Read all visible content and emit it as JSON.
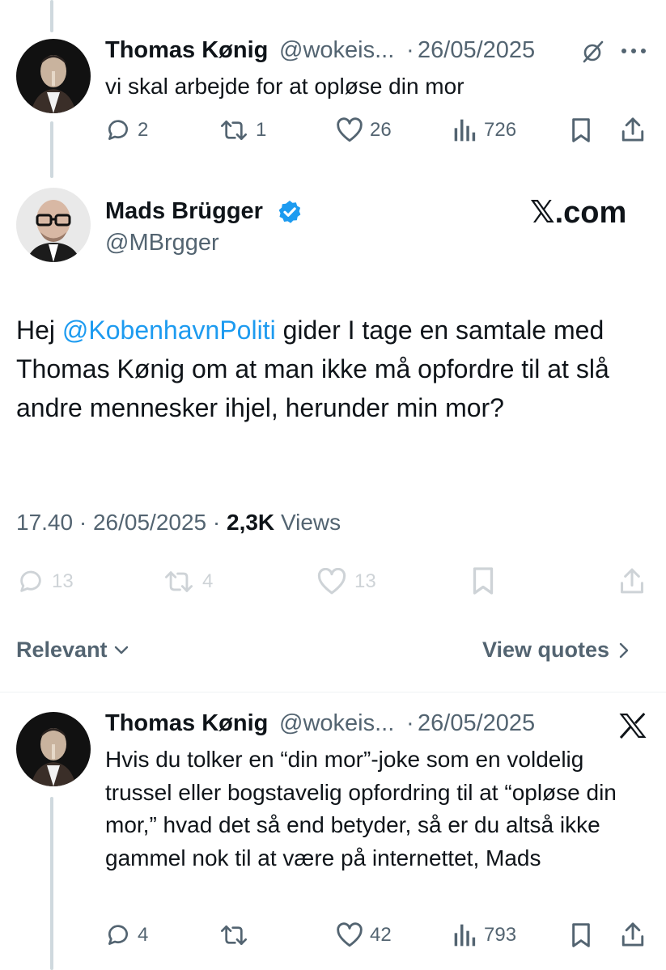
{
  "tweet1": {
    "author_name": "Thomas Kønig",
    "handle": "@wokeis...",
    "separator": "·",
    "date": "26/05/2025",
    "text": "vi skal arbejde for at opløse din mor",
    "replies": "2",
    "reposts": "1",
    "likes": "26",
    "views": "726"
  },
  "main_tweet": {
    "author_name": "Mads Brügger",
    "handle": "@MBrgger",
    "watermark": "𝕏.com",
    "text_before": "Hej ",
    "mention": "@KobenhavnPoliti",
    "text_after": " gider I tage en samtale med Thomas Kønig om at man ikke må opfordre til at slå andre mennesker ihjel, herunder min mor?",
    "time": "17.40",
    "separator": "·",
    "date": "26/05/2025",
    "separator2": "·",
    "views_count": "2,3K",
    "views_label": "Views",
    "replies": "13",
    "reposts": "4",
    "likes": "13"
  },
  "replies_header": {
    "sort_label": "Relevant",
    "quotes_label": "View quotes"
  },
  "tweet2": {
    "author_name": "Thomas Kønig",
    "handle": "@wokeis...",
    "separator": "·",
    "date": "26/05/2025",
    "text": "Hvis du tolker en “din mor”-joke som en voldelig trussel eller bogstavelig opfordring til at “opløse din mor,” hvad det så end betyder, så er du altså ikke gammel nok til at være på internettet, Mads",
    "replies": "4",
    "likes": "42",
    "views": "793"
  },
  "icons": {
    "verified": "verified-badge-icon",
    "grok": "grok-icon",
    "more": "more-icon",
    "reply": "reply-icon",
    "repost": "repost-icon",
    "like": "like-icon",
    "views": "views-icon",
    "bookmark": "bookmark-icon",
    "share": "share-icon",
    "x_logo": "x-logo-icon"
  },
  "colors": {
    "text": "#0f1419",
    "muted": "#536471",
    "link": "#1d9bf0",
    "verified": "#1d9bf0",
    "thread_line": "#cfd9de"
  }
}
